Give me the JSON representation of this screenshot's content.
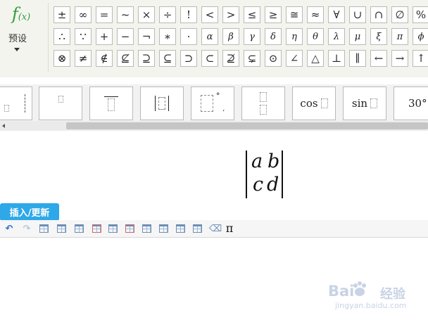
{
  "preset": {
    "fx_label": "f",
    "fx_sub": "(x)",
    "label": "预设"
  },
  "symbols": {
    "row1": [
      "±",
      "∞",
      "=",
      "~",
      "×",
      "÷",
      "!",
      "<",
      ">",
      "≤",
      "≥",
      "≅",
      "≈",
      "∀",
      "∪",
      "∩",
      "∅",
      "%"
    ],
    "row2": [
      "∴",
      "∵",
      "+",
      "−",
      "¬",
      "∗",
      "·",
      "α",
      "β",
      "γ",
      "δ",
      "η",
      "θ",
      "λ",
      "μ",
      "ξ",
      "π",
      "ϕ"
    ],
    "row3": [
      "⊗",
      "≠",
      "∉",
      "⊈",
      "⊇",
      "⊆",
      "⊃",
      "⊂",
      "⊉",
      "⊊",
      "⊙",
      "∠",
      "△",
      "⊥",
      "∥",
      "←",
      "→",
      "↑"
    ]
  },
  "templates": {
    "cos": "cos",
    "sin": "sin",
    "deg": "30°"
  },
  "formula": {
    "a": "a",
    "b": "b",
    "c": "c",
    "d": "d"
  },
  "actions": {
    "insert_update": "插入/更新"
  },
  "toolbar": {
    "pi": "π"
  },
  "watermark": {
    "brand": "Bai",
    "brand_cn": "经验",
    "domain": "jingyan.baidu.com"
  },
  "colors": {
    "accent": "#2ea8e8",
    "fx_green": "#2e9c3e"
  }
}
